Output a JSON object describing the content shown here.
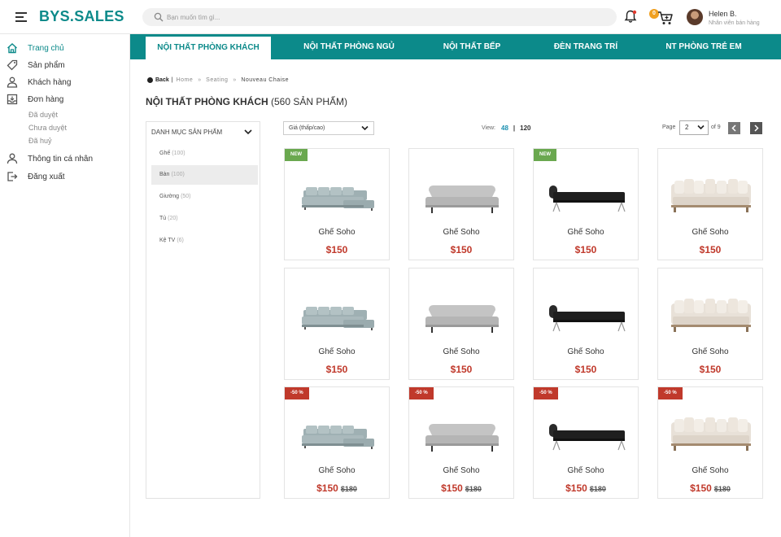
{
  "app": {
    "logo": "BYS.SALES",
    "search_placeholder": "Bạn muốn tìm gì...",
    "cart_count": "0",
    "user": {
      "name": "Helen B.",
      "role": "Nhân viên bán hàng"
    },
    "accent_color": "#0c8a8a"
  },
  "sidebar": {
    "items": [
      {
        "label": "Trang chủ",
        "icon": "home-icon"
      },
      {
        "label": "Sản phẩm",
        "icon": "tag-icon"
      },
      {
        "label": "Khách hàng",
        "icon": "users-icon"
      },
      {
        "label": "Đơn hàng",
        "icon": "inbox-icon"
      },
      {
        "label": "Thông tin cá nhân",
        "icon": "user-icon"
      },
      {
        "label": "Đăng xuất",
        "icon": "logout-icon"
      }
    ],
    "order_sub": [
      "Đã duyệt",
      "Chưa duyệt",
      "Đã huỷ"
    ]
  },
  "tabs": [
    "NỘI THẤT PHÒNG KHÁCH",
    "NỘI THẤT PHÒNG NGỦ",
    "NỘI THẤT BẾP",
    "ĐÈN TRANG TRÍ",
    "NT PHÒNG TRẺ EM"
  ],
  "breadcrumb": {
    "back": "Back",
    "crumbs": [
      "Home",
      "Seating",
      "Nouveau Chaise"
    ]
  },
  "page": {
    "title": "NỘI THẤT PHÒNG KHÁCH",
    "count": "(560 SẢN PHẨM)"
  },
  "categories": {
    "header": "DANH MỤC SẢN PHẨM",
    "items": [
      {
        "label": "Ghế",
        "count": "(100)"
      },
      {
        "label": "Bàn",
        "count": "(100)"
      },
      {
        "label": "Giường",
        "count": "(50)"
      },
      {
        "label": "Tủ",
        "count": "(20)"
      },
      {
        "label": "Kệ TV",
        "count": "(6)"
      }
    ]
  },
  "toolbar": {
    "sort": "Giá (thấp/cao)",
    "view_label": "View:",
    "view_options": [
      "48",
      "120"
    ],
    "page_label": "Page",
    "page_value": "2",
    "page_of": "of 9"
  },
  "products": [
    {
      "name": "Ghế Soho",
      "price": "$150",
      "old_price": "",
      "badge": "",
      "style": "sectional"
    },
    {
      "name": "Ghế Soho",
      "price": "$150",
      "old_price": "",
      "badge": "",
      "style": "grey-sofa"
    },
    {
      "name": "Ghế Soho",
      "price": "$150",
      "old_price": "",
      "badge": "NEW",
      "style": "daybed"
    },
    {
      "name": "Ghế Soho",
      "price": "$150",
      "old_price": "",
      "badge": "",
      "style": "cream-sofa"
    },
    {
      "name": "Ghế Soho",
      "price": "$150",
      "old_price": "",
      "badge": "",
      "style": "sectional"
    },
    {
      "name": "Ghế Soho",
      "price": "$150",
      "old_price": "",
      "badge": "",
      "style": "grey-sofa"
    },
    {
      "name": "Ghế Soho",
      "price": "$150",
      "old_price": "",
      "badge": "",
      "style": "daybed"
    },
    {
      "name": "Ghế Soho",
      "price": "$150",
      "old_price": "",
      "badge": "",
      "style": "cream-sofa"
    },
    {
      "name": "Ghế Soho",
      "price": "$150",
      "old_price": "$180",
      "badge": "-50 %",
      "style": "sectional"
    },
    {
      "name": "Ghế Soho",
      "price": "$150",
      "old_price": "$180",
      "badge": "-50 %",
      "style": "grey-sofa"
    },
    {
      "name": "Ghế Soho",
      "price": "$150",
      "old_price": "$180",
      "badge": "-50 %",
      "style": "daybed"
    },
    {
      "name": "Ghế Soho",
      "price": "$150",
      "old_price": "$180",
      "badge": "-50 %",
      "style": "cream-sofa"
    }
  ],
  "first_badge": "NEW"
}
